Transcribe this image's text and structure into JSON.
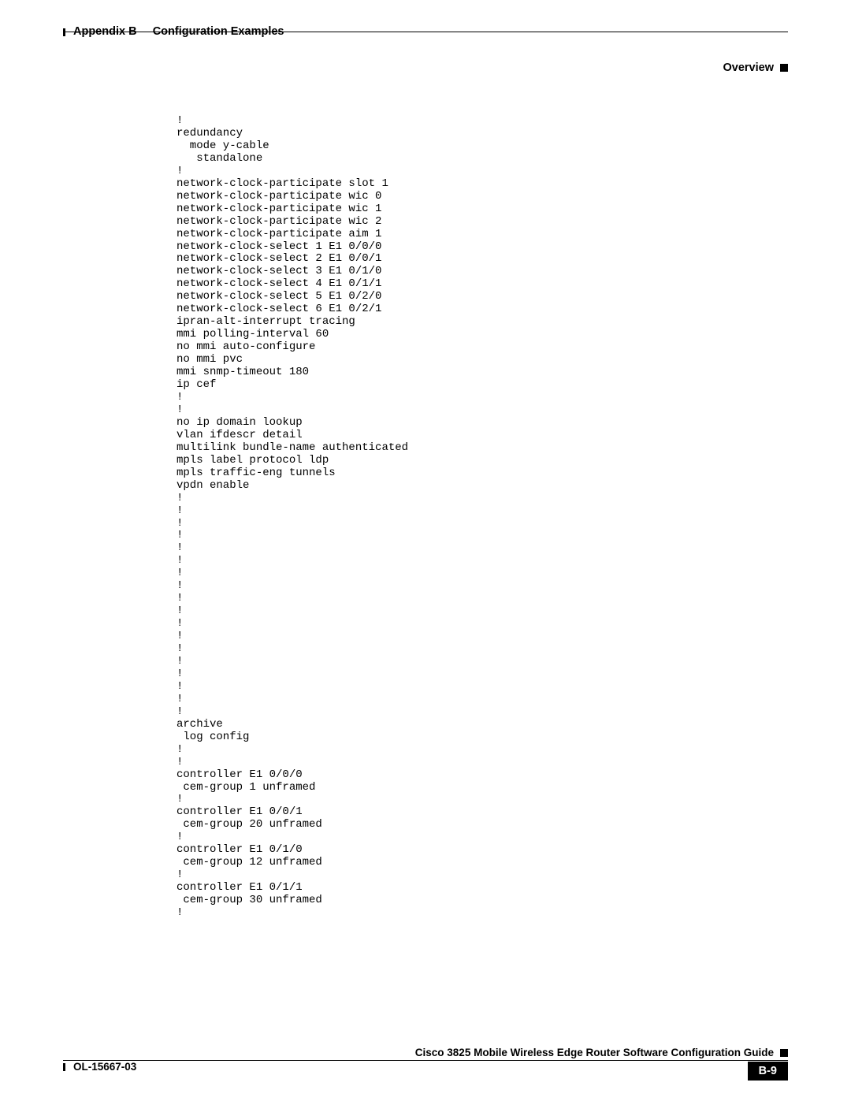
{
  "header": {
    "appendix": "Appendix B     Configuration Examples",
    "section": "Overview"
  },
  "config_lines": [
    "!",
    "redundancy",
    "  mode y-cable",
    "   standalone",
    "!",
    "network-clock-participate slot 1",
    "network-clock-participate wic 0",
    "network-clock-participate wic 1",
    "network-clock-participate wic 2",
    "network-clock-participate aim 1",
    "network-clock-select 1 E1 0/0/0",
    "network-clock-select 2 E1 0/0/1",
    "network-clock-select 3 E1 0/1/0",
    "network-clock-select 4 E1 0/1/1",
    "network-clock-select 5 E1 0/2/0",
    "network-clock-select 6 E1 0/2/1",
    "ipran-alt-interrupt tracing",
    "mmi polling-interval 60",
    "no mmi auto-configure",
    "no mmi pvc",
    "mmi snmp-timeout 180",
    "ip cef",
    "!",
    "!",
    "no ip domain lookup",
    "vlan ifdescr detail",
    "multilink bundle-name authenticated",
    "mpls label protocol ldp",
    "mpls traffic-eng tunnels",
    "vpdn enable",
    "!",
    "!",
    "!",
    "!",
    "!",
    "!",
    "!",
    "!",
    "!",
    "!",
    "!",
    "!",
    "!",
    "!",
    "!",
    "!",
    "!",
    "!",
    "archive",
    " log config",
    "!",
    "!",
    "controller E1 0/0/0",
    " cem-group 1 unframed",
    "!",
    "controller E1 0/0/1",
    " cem-group 20 unframed",
    "!",
    "controller E1 0/1/0",
    " cem-group 12 unframed",
    "!",
    "controller E1 0/1/1",
    " cem-group 30 unframed",
    "!"
  ],
  "footer": {
    "guide": "Cisco 3825 Mobile Wireless Edge Router Software Configuration Guide",
    "docref": "OL-15667-03",
    "pagenum": "B-9"
  }
}
